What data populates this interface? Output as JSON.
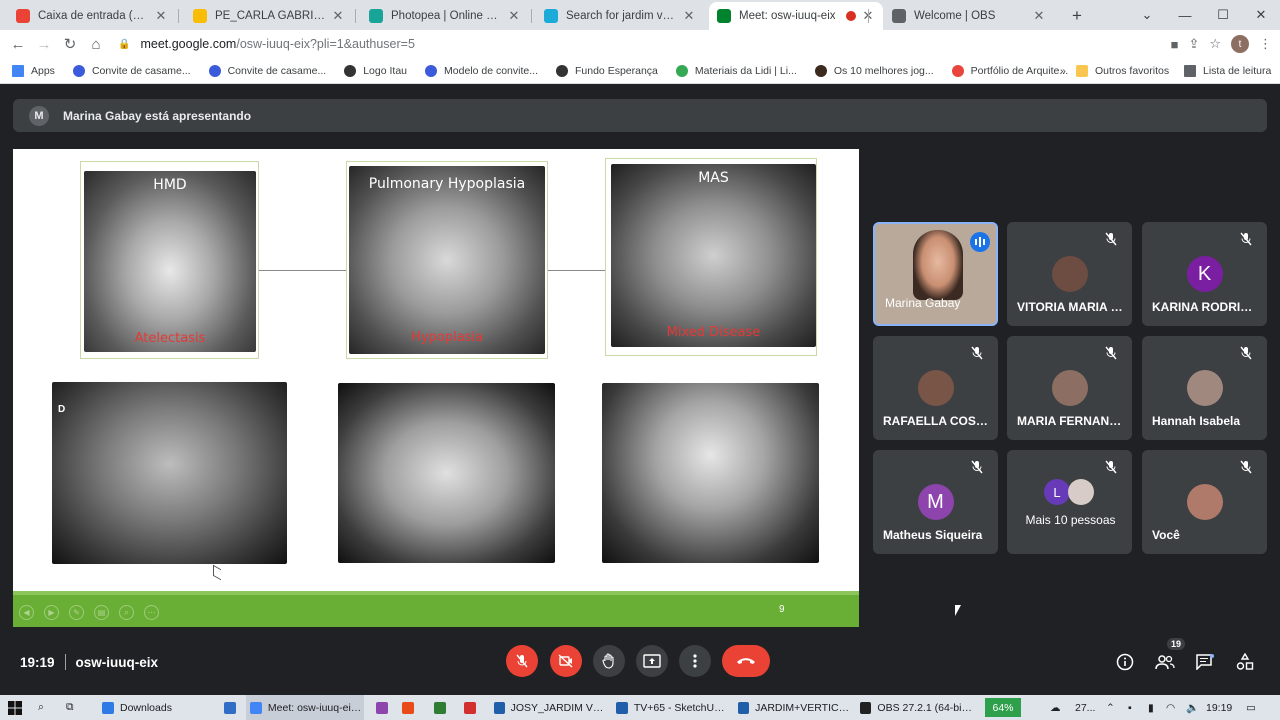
{
  "browser": {
    "tabs": [
      {
        "title": "Caixa de entrada (126) - th",
        "icon": "gmail-icon",
        "color": "#ea4335"
      },
      {
        "title": "PE_CARLA GABRIEL_DET. FA",
        "icon": "drive-icon",
        "color": "#fbbc04"
      },
      {
        "title": "Photopea | Online Photo Ed",
        "icon": "photopea-icon",
        "color": "#18a497"
      },
      {
        "title": "Search for jardim vertical |",
        "icon": "sketchfab-icon",
        "color": "#1caad9"
      },
      {
        "title": "Meet: osw-iuuq-eix",
        "icon": "meet-icon",
        "color": "#00832d",
        "active": true
      },
      {
        "title": "",
        "icon": "record-icon",
        "color": "#d93025"
      },
      {
        "title": "Welcome | OBS",
        "icon": "globe-icon",
        "color": "#5f6368"
      }
    ],
    "new_tab": "+",
    "url_host": "meet.google.com",
    "url_path": "/osw-iuuq-eix?pli=1&authuser=5",
    "profile_initial": "t",
    "bookmarks": [
      {
        "label": "Apps",
        "color": "#4285f4"
      },
      {
        "label": "Convite de casame...",
        "color": "#3b5bdb"
      },
      {
        "label": "Convite de casame...",
        "color": "#3b5bdb"
      },
      {
        "label": "Logo Itau",
        "color": "#333333"
      },
      {
        "label": "Modelo de convite...",
        "color": "#3b5bdb"
      },
      {
        "label": "Fundo Esperança",
        "color": "#333333"
      },
      {
        "label": "Materiais da Lidi | Li...",
        "color": "#34a853"
      },
      {
        "label": "Os 10 melhores jog...",
        "color": "#3c2a1e"
      },
      {
        "label": "Portfólio de Arquite...",
        "color": "#e8453c"
      }
    ],
    "bookmarks_more": "»",
    "other_favorites": "Outros favoritos",
    "reading_list": "Lista de leitura"
  },
  "meet": {
    "presenting_initial": "M",
    "presenting_text": "Marina Gabay está apresentando",
    "slide": {
      "top_images": [
        {
          "title": "HMD",
          "caption": "Atelectasis"
        },
        {
          "title": "Pulmonary Hypoplasia",
          "caption": "Hypoplasia"
        },
        {
          "title": "MAS",
          "caption": "Mixed Disease"
        }
      ],
      "bottom_label": "D",
      "page_number": "9"
    },
    "participants": [
      {
        "name": "Marina Gabay",
        "speaking": true
      },
      {
        "name": "VITORIA MARIA L...",
        "avatar_color": "#6d4c41"
      },
      {
        "name": "KARINA RODRIG...",
        "initial": "K",
        "avatar_color": "#7b1fa2"
      },
      {
        "name": "RAFAELLA COST...",
        "avatar_color": "#795548"
      },
      {
        "name": "MARIA FERNAND...",
        "avatar_color": "#8d6e63"
      },
      {
        "name": "Hannah Isabela",
        "avatar_color": "#a1887f"
      },
      {
        "name": "Matheus Siqueira",
        "initial": "M",
        "avatar_color": "#8e44ad"
      },
      {
        "name": "Mais 10 pessoas",
        "initial": "L",
        "avatar_color": "#673ab7"
      },
      {
        "name": "Você",
        "avatar_color": "#b07a6a"
      }
    ],
    "time": "19:19",
    "meeting_code": "osw-iuuq-eix",
    "people_count": "19"
  },
  "taskbar": {
    "items": [
      {
        "label": "Downloads",
        "color": "#2f7be5"
      },
      {
        "label": "",
        "color": "#2f6dc6"
      },
      {
        "label": "Meet: osw-iuuq-eix...",
        "color": "#4285f4",
        "active": true
      },
      {
        "label": "",
        "color": "#8e44ad"
      },
      {
        "label": "",
        "color": "#e84a1a"
      },
      {
        "label": "",
        "color": "#2e7d32"
      },
      {
        "label": "",
        "color": "#d32f2f"
      },
      {
        "label": "JOSY_JARDIM VERT...",
        "color": "#1f5ea8"
      },
      {
        "label": "TV+65 - SketchUp ...",
        "color": "#1f5ea8"
      },
      {
        "label": "JARDIM+VERTICAL...",
        "color": "#1f5ea8"
      },
      {
        "label": "OBS 27.2.1 (64-bit, ...",
        "color": "#222222"
      }
    ],
    "battery": "64%",
    "temperature": "27...",
    "clock": "19:19"
  }
}
